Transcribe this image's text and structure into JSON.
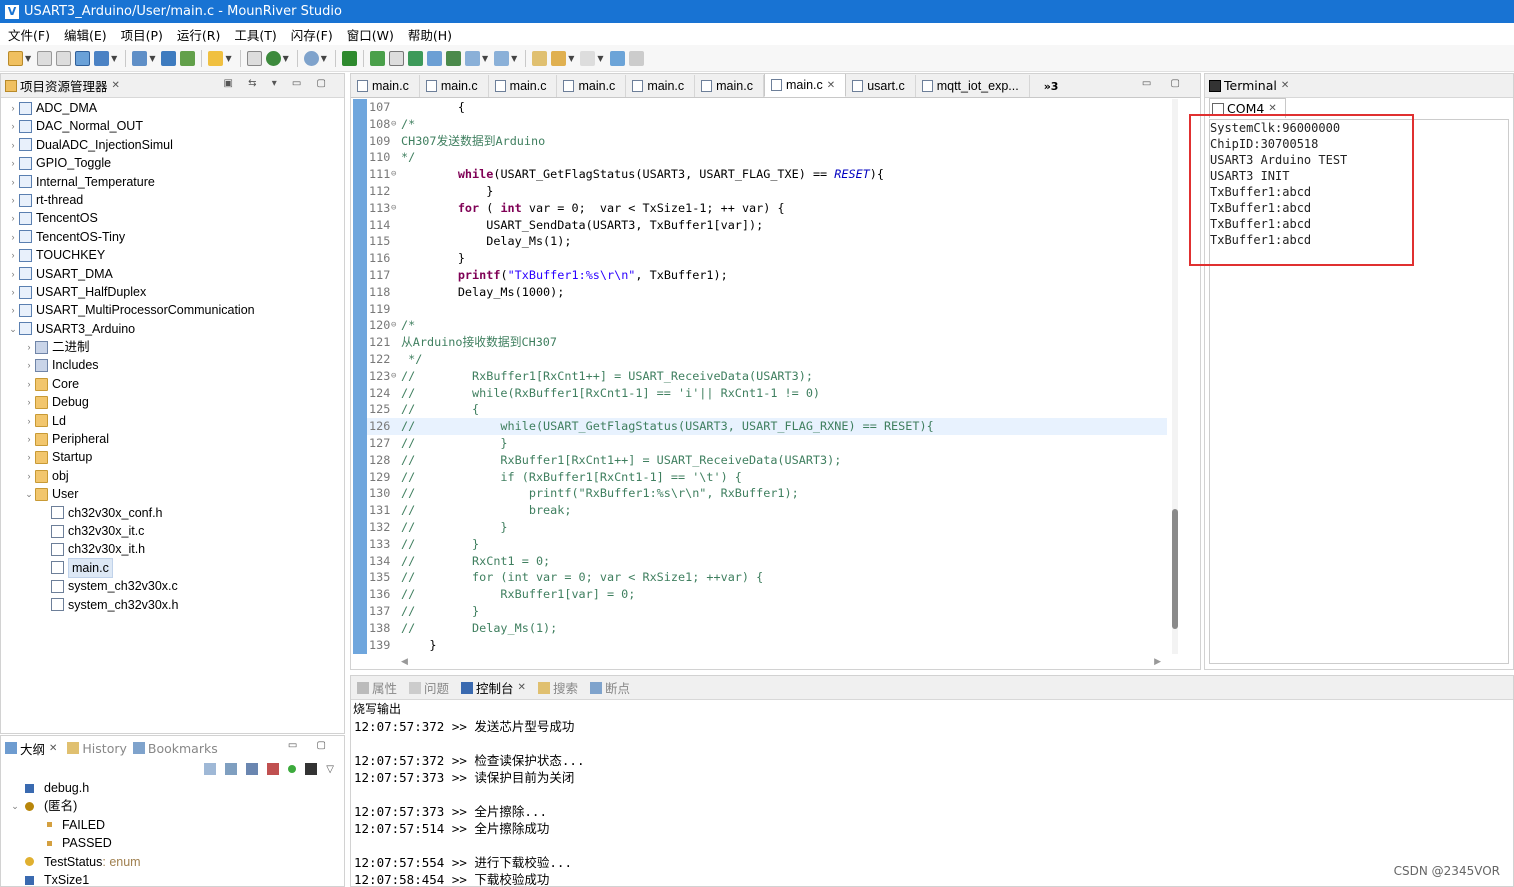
{
  "window": {
    "title": "USART3_Arduino/User/main.c - MounRiver Studio"
  },
  "menu": [
    "文件(F)",
    "编辑(E)",
    "项目(P)",
    "运行(R)",
    "工具(T)",
    "闪存(F)",
    "窗口(W)",
    "帮助(H)"
  ],
  "project_explorer": {
    "title": "项目资源管理器",
    "items": [
      {
        "label": "ADC_DMA",
        "level": 0,
        "type": "project",
        "expanded": false
      },
      {
        "label": "DAC_Normal_OUT",
        "level": 0,
        "type": "project",
        "expanded": false
      },
      {
        "label": "DualADC_InjectionSimul",
        "level": 0,
        "type": "project",
        "expanded": false
      },
      {
        "label": "GPIO_Toggle",
        "level": 0,
        "type": "project",
        "expanded": false
      },
      {
        "label": "Internal_Temperature",
        "level": 0,
        "type": "project",
        "expanded": false
      },
      {
        "label": "rt-thread",
        "level": 0,
        "type": "project",
        "expanded": false
      },
      {
        "label": "TencentOS",
        "level": 0,
        "type": "project",
        "expanded": false
      },
      {
        "label": "TencentOS-Tiny",
        "level": 0,
        "type": "project",
        "expanded": false
      },
      {
        "label": "TOUCHKEY",
        "level": 0,
        "type": "project",
        "expanded": false
      },
      {
        "label": "USART_DMA",
        "level": 0,
        "type": "project",
        "expanded": false
      },
      {
        "label": "USART_HalfDuplex",
        "level": 0,
        "type": "project",
        "expanded": false
      },
      {
        "label": "USART_MultiProcessorCommunication",
        "level": 0,
        "type": "project",
        "expanded": false
      },
      {
        "label": "USART3_Arduino",
        "level": 0,
        "type": "project",
        "expanded": true
      },
      {
        "label": "二进制",
        "level": 1,
        "type": "binary",
        "expanded": false
      },
      {
        "label": "Includes",
        "level": 1,
        "type": "includes",
        "expanded": false
      },
      {
        "label": "Core",
        "level": 1,
        "type": "srcfolder",
        "expanded": false
      },
      {
        "label": "Debug",
        "level": 1,
        "type": "srcfolder",
        "expanded": false
      },
      {
        "label": "Ld",
        "level": 1,
        "type": "srcfolder",
        "expanded": false
      },
      {
        "label": "Peripheral",
        "level": 1,
        "type": "srcfolder",
        "expanded": false
      },
      {
        "label": "Startup",
        "level": 1,
        "type": "srcfolder",
        "expanded": false
      },
      {
        "label": "obj",
        "level": 1,
        "type": "folder",
        "expanded": false
      },
      {
        "label": "User",
        "level": 1,
        "type": "folder",
        "expanded": true
      },
      {
        "label": "ch32v30x_conf.h",
        "level": 2,
        "type": "file"
      },
      {
        "label": "ch32v30x_it.c",
        "level": 2,
        "type": "file"
      },
      {
        "label": "ch32v30x_it.h",
        "level": 2,
        "type": "file"
      },
      {
        "label": "main.c",
        "level": 2,
        "type": "file",
        "selected": true
      },
      {
        "label": "system_ch32v30x.c",
        "level": 2,
        "type": "file"
      },
      {
        "label": "system_ch32v30x.h",
        "level": 2,
        "type": "file"
      }
    ]
  },
  "outline": {
    "tabs": [
      "大纲",
      "History",
      "Bookmarks"
    ],
    "items": [
      {
        "label": "debug.h",
        "level": 0,
        "type": "include"
      },
      {
        "label": "(匿名)",
        "level": 0,
        "type": "enum",
        "expanded": true
      },
      {
        "label": "FAILED",
        "level": 1,
        "type": "enumerator"
      },
      {
        "label": "PASSED",
        "level": 1,
        "type": "enumerator"
      },
      {
        "label": "TestStatus",
        "suffix": " : enum",
        "level": 0,
        "type": "typedef"
      },
      {
        "label": "TxSize1",
        "level": 0,
        "type": "define"
      }
    ]
  },
  "editor": {
    "tabs": [
      "main.c",
      "main.c",
      "main.c",
      "main.c",
      "main.c",
      "main.c",
      "main.c",
      "usart.c",
      "mqtt_iot_exp..."
    ],
    "active_tab": 6,
    "overflow": "»3",
    "lines": [
      {
        "n": "107",
        "fold": "",
        "t": [
          [
            "ct",
            "        {"
          ]
        ]
      },
      {
        "n": "108",
        "fold": "⊖",
        "t": [
          [
            "cm",
            "/*"
          ]
        ]
      },
      {
        "n": "109",
        "fold": "",
        "t": [
          [
            "cm",
            "CH307发送数据到Arduino"
          ]
        ]
      },
      {
        "n": "110",
        "fold": "",
        "t": [
          [
            "cm",
            "*/"
          ]
        ]
      },
      {
        "n": "111",
        "fold": "⊖",
        "t": [
          [
            "ct",
            "        "
          ],
          [
            "kw",
            "while"
          ],
          [
            "ct",
            "(USART_GetFlagStatus(USART3, USART_FLAG_TXE) == "
          ],
          [
            "it",
            "RESET"
          ],
          [
            "ct",
            "){"
          ]
        ]
      },
      {
        "n": "112",
        "fold": "",
        "t": [
          [
            "ct",
            "            }"
          ]
        ]
      },
      {
        "n": "113",
        "fold": "⊖",
        "t": [
          [
            "ct",
            "        "
          ],
          [
            "kw",
            "for"
          ],
          [
            "ct",
            " ( "
          ],
          [
            "kw",
            "int"
          ],
          [
            "ct",
            " var = 0;  var < TxSize1-1; ++ var) {"
          ]
        ]
      },
      {
        "n": "114",
        "fold": "",
        "t": [
          [
            "ct",
            "            USART_SendData(USART3, TxBuffer1[var]);"
          ]
        ]
      },
      {
        "n": "115",
        "fold": "",
        "t": [
          [
            "ct",
            "            Delay_Ms(1);"
          ]
        ]
      },
      {
        "n": "116",
        "fold": "",
        "t": [
          [
            "ct",
            "        }"
          ]
        ]
      },
      {
        "n": "117",
        "fold": "",
        "t": [
          [
            "ct",
            "        "
          ],
          [
            "kw",
            "printf"
          ],
          [
            "ct",
            "("
          ],
          [
            "str",
            "\"TxBuffer1:%s\\r\\n\""
          ],
          [
            "ct",
            ", TxBuffer1);"
          ]
        ]
      },
      {
        "n": "118",
        "fold": "",
        "t": [
          [
            "ct",
            "        Delay_Ms(1000);"
          ]
        ]
      },
      {
        "n": "119",
        "fold": "",
        "t": [
          [
            "ct",
            ""
          ]
        ]
      },
      {
        "n": "120",
        "fold": "⊖",
        "t": [
          [
            "cm",
            "/*"
          ]
        ]
      },
      {
        "n": "121",
        "fold": "",
        "t": [
          [
            "cm",
            "从Arduino接收数据到CH307"
          ]
        ]
      },
      {
        "n": "122",
        "fold": "",
        "t": [
          [
            "cm",
            " */"
          ]
        ]
      },
      {
        "n": "123",
        "fold": "⊖",
        "t": [
          [
            "cm",
            "//        RxBuffer1[RxCnt1++] = USART_ReceiveData(USART3);"
          ]
        ]
      },
      {
        "n": "124",
        "fold": "",
        "t": [
          [
            "cm",
            "//        while(RxBuffer1[RxCnt1-1] == 'i'|| RxCnt1-1 != 0)"
          ]
        ]
      },
      {
        "n": "125",
        "fold": "",
        "t": [
          [
            "cm",
            "//        {"
          ]
        ]
      },
      {
        "n": "126",
        "fold": "",
        "t": [
          [
            "cm",
            "//            while(USART_GetFlagStatus(USART3, USART_FLAG_RXNE) == RESET){"
          ]
        ],
        "highlight": true
      },
      {
        "n": "127",
        "fold": "",
        "t": [
          [
            "cm",
            "//            }"
          ]
        ]
      },
      {
        "n": "128",
        "fold": "",
        "t": [
          [
            "cm",
            "//            RxBuffer1[RxCnt1++] = USART_ReceiveData(USART3);"
          ]
        ]
      },
      {
        "n": "129",
        "fold": "",
        "t": [
          [
            "cm",
            "//            if (RxBuffer1[RxCnt1-1] == '\\t') {"
          ]
        ]
      },
      {
        "n": "130",
        "fold": "",
        "t": [
          [
            "cm",
            "//                printf(\"RxBuffer1:%s\\r\\n\", RxBuffer1);"
          ]
        ]
      },
      {
        "n": "131",
        "fold": "",
        "t": [
          [
            "cm",
            "//                break;"
          ]
        ]
      },
      {
        "n": "132",
        "fold": "",
        "t": [
          [
            "cm",
            "//            }"
          ]
        ]
      },
      {
        "n": "133",
        "fold": "",
        "t": [
          [
            "cm",
            "//        }"
          ]
        ]
      },
      {
        "n": "134",
        "fold": "",
        "t": [
          [
            "cm",
            "//        RxCnt1 = 0;"
          ]
        ]
      },
      {
        "n": "135",
        "fold": "",
        "t": [
          [
            "cm",
            "//        for (int var = 0; var < RxSize1; ++var) {"
          ]
        ]
      },
      {
        "n": "136",
        "fold": "",
        "t": [
          [
            "cm",
            "//            RxBuffer1[var] = 0;"
          ]
        ]
      },
      {
        "n": "137",
        "fold": "",
        "t": [
          [
            "cm",
            "//        }"
          ]
        ]
      },
      {
        "n": "138",
        "fold": "",
        "t": [
          [
            "cm",
            "//        Delay_Ms(1);"
          ]
        ]
      },
      {
        "n": "139",
        "fold": "",
        "t": [
          [
            "ct",
            "    }"
          ]
        ]
      }
    ]
  },
  "terminal": {
    "title": "Terminal",
    "tab": "COM4",
    "lines": [
      "SystemClk:96000000",
      "ChipID:30700518",
      "USART3 Arduino TEST",
      "USART3 INIT",
      "TxBuffer1:abcd",
      "TxBuffer1:abcd",
      "TxBuffer1:abcd",
      "TxBuffer1:abcd"
    ],
    "highlight_color": "#e03030"
  },
  "bottom_panel": {
    "tabs": [
      "属性",
      "问题",
      "控制台",
      "搜索",
      "断点"
    ],
    "active_tab": 2,
    "console_title": "烧写输出",
    "lines": [
      "12:07:57:372 >> 发送芯片型号成功",
      "",
      "12:07:57:372 >> 检查读保护状态...",
      "12:07:57:373 >> 读保护目前为关闭",
      "",
      "12:07:57:373 >> 全片擦除...",
      "12:07:57:514 >> 全片擦除成功",
      "",
      "12:07:57:554 >> 进行下载校验...",
      "12:07:58:454 >> 下载校验成功"
    ]
  },
  "watermark": "CSDN @2345VOR",
  "colors": {
    "title_bar": "#1873d3",
    "keyword": "#7f0055",
    "comment": "#3f7f5f",
    "string": "#2a00ff",
    "selection": "#dde8f5"
  }
}
